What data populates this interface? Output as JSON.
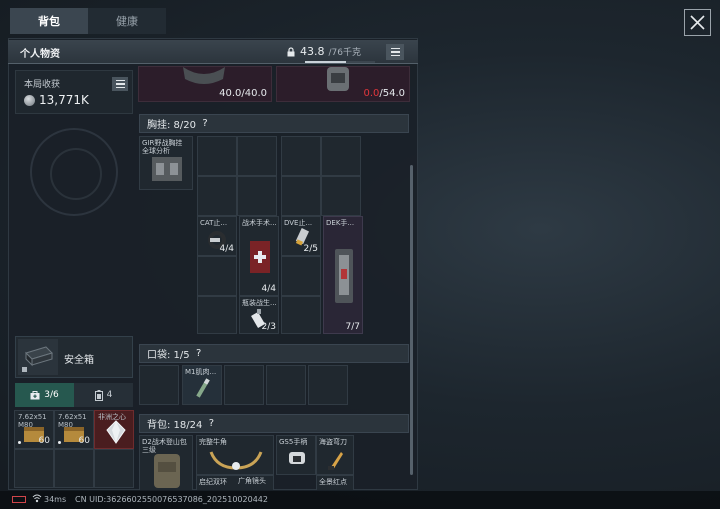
{
  "tabs": [
    {
      "label": "背包",
      "active": true
    },
    {
      "label": "健康",
      "active": false
    }
  ],
  "panel": {
    "title": "个人物资",
    "weight_current": "43.8",
    "weight_max": "/76千克",
    "weight_fraction": 0.58
  },
  "harvest": {
    "label": "本局收获",
    "value": "13,771K"
  },
  "equipped": [
    {
      "value": "40.0/40.0",
      "over": false
    },
    {
      "value_red": "0.0",
      "value_rest": "/54.0"
    }
  ],
  "chest_rig": {
    "header": "胸挂: 8/20",
    "help": "?",
    "item_name": "GIR野战胸挂",
    "item_subname": "全球分析",
    "items": [
      {
        "name": "CAT止...",
        "qty": "4/4"
      },
      {
        "name": "战术手术...",
        "qty": "4/4"
      },
      {
        "name": "DVE止...",
        "qty": "2/5"
      },
      {
        "name": "DEK手...",
        "qty": "7/7"
      },
      {
        "name": "瓶装战生...",
        "qty": "2/3"
      }
    ]
  },
  "pocket": {
    "header": "口袋: 1/5",
    "help": "?",
    "items": [
      {
        "name": "M1肌肉..."
      }
    ]
  },
  "backpack": {
    "header": "背包: 18/24",
    "help": "?",
    "item_name": "D2战术登山包",
    "item_subname": "三级",
    "items": [
      {
        "name": "完整牛角",
        "sub": "启纪双环"
      },
      {
        "name": "GS5手柄",
        "sub": "广角镜头"
      },
      {
        "name": "海盗弯刀",
        "sub": "全景红点"
      }
    ]
  },
  "safebox": {
    "label": "安全箱"
  },
  "subtabs": [
    {
      "label": "3/6",
      "icon": "medkit-icon"
    },
    {
      "label": "4",
      "icon": "battery-icon"
    }
  ],
  "safe_items": [
    {
      "name": "7.62x51",
      "sub": "M80",
      "qty": "60"
    },
    {
      "name": "7.62x51",
      "sub": "M80",
      "qty": "60"
    },
    {
      "name": "非洲之心"
    }
  ],
  "statusbar": {
    "ping": "34ms",
    "uid": "CN UID:3626602550076537086_202510020442"
  },
  "colors": {
    "accent": "#26584f",
    "warning": "#e0363c",
    "panel": "#1a2128"
  }
}
